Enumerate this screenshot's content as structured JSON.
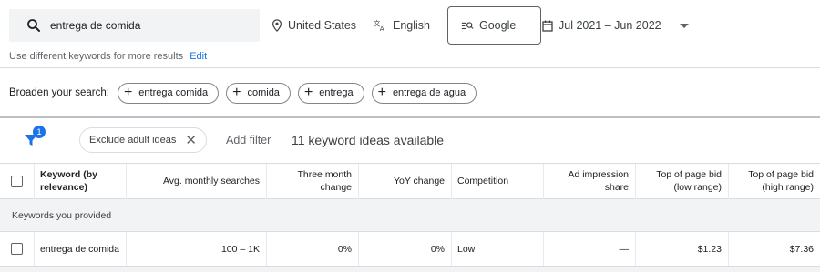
{
  "search": {
    "keyword": "entrega de comida"
  },
  "location": {
    "label": "United States"
  },
  "language": {
    "label": "English"
  },
  "network": {
    "label": "Google"
  },
  "date_range": {
    "label": "Jul 2021 – Jun 2022"
  },
  "hint": {
    "text": "Use different keywords for more results",
    "edit": "Edit"
  },
  "broaden": {
    "label": "Broaden your search:",
    "chips": [
      "entrega comida",
      "comida",
      "entrega",
      "entrega de agua"
    ]
  },
  "filters": {
    "badge_count": "1",
    "exclude_chip": "Exclude adult ideas",
    "add_filter": "Add filter",
    "ideas_count": "11 keyword ideas available"
  },
  "table": {
    "headers": {
      "keyword": "Keyword (by relevance)",
      "avg_searches": "Avg. monthly searches",
      "three_month": "Three month change",
      "yoy": "YoY change",
      "competition": "Competition",
      "ad_share": "Ad impression share",
      "bid_low": "Top of page bid (low range)",
      "bid_high": "Top of page bid (high range)"
    },
    "group_label": "Keywords you provided",
    "rows": [
      {
        "keyword": "entrega de comida",
        "avg_searches": "100 – 1K",
        "three_month": "0%",
        "yoy": "0%",
        "competition": "Low",
        "ad_share": "—",
        "bid_low": "$1.23",
        "bid_high": "$7.36"
      }
    ]
  },
  "colors": {
    "accent": "#1a73e8",
    "chip_border": "#80868b",
    "surface": "#f1f3f4"
  },
  "icons": [
    "search-icon",
    "location-pin-icon",
    "translate-icon",
    "network-search-icon",
    "calendar-icon",
    "dropdown-caret-icon",
    "plus-icon",
    "filter-icon",
    "close-icon"
  ]
}
